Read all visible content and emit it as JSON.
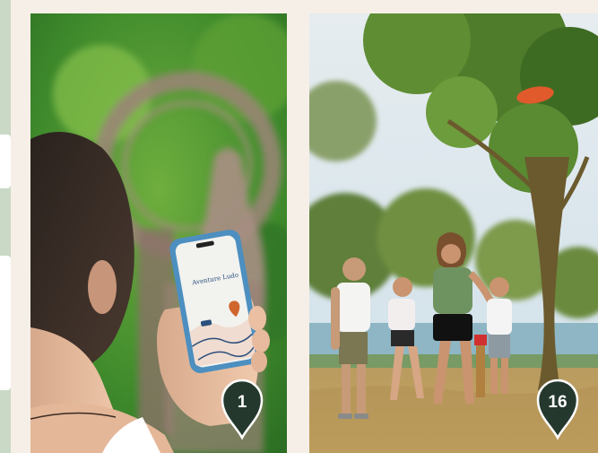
{
  "gallery": {
    "cards": [
      {
        "alt": "Woman holding a smartphone showing a map app in front of a sundial sculpture",
        "pin_number": "1",
        "phone_app_text": "Aventure Ludo"
      },
      {
        "alt": "Family playing with a flying disc near a tree by the water",
        "pin_number": "16"
      }
    ]
  },
  "colors": {
    "page_background": "#f6efe7",
    "pin_fill": "#24382e",
    "pin_border": "#ffffff",
    "side_strip": "#c9d9c6"
  },
  "icons": {
    "pin": "map-pin-icon",
    "phone_location": "location-pin-icon"
  }
}
